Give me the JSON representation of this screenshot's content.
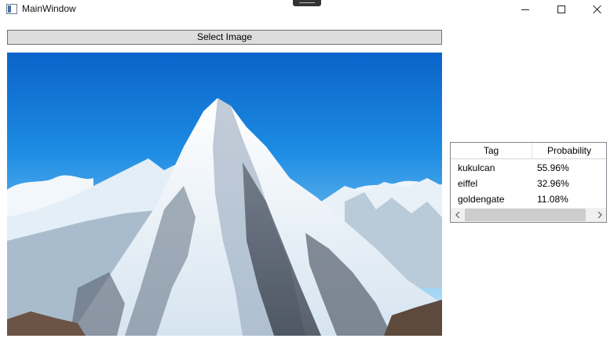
{
  "window": {
    "title": "MainWindow",
    "icon": "app-window-icon",
    "controls": [
      "minimize-icon",
      "maximize-icon",
      "close-icon"
    ]
  },
  "toolbar": {
    "select_label": "Select Image"
  },
  "image": {
    "subject": "snow-capped mountain peak"
  },
  "results": {
    "columns": [
      "Tag",
      "Probability"
    ],
    "rows": [
      {
        "tag": "kukulcan",
        "probability": "55.96%"
      },
      {
        "tag": "eiffel",
        "probability": "32.96%"
      },
      {
        "tag": "goldengate",
        "probability": "11.08%"
      }
    ]
  },
  "colors": {
    "sky_top": "#0f6fd4",
    "sky_bottom": "#bfe3f8",
    "button_face": "#dddddd",
    "grid_border": "#828790"
  }
}
